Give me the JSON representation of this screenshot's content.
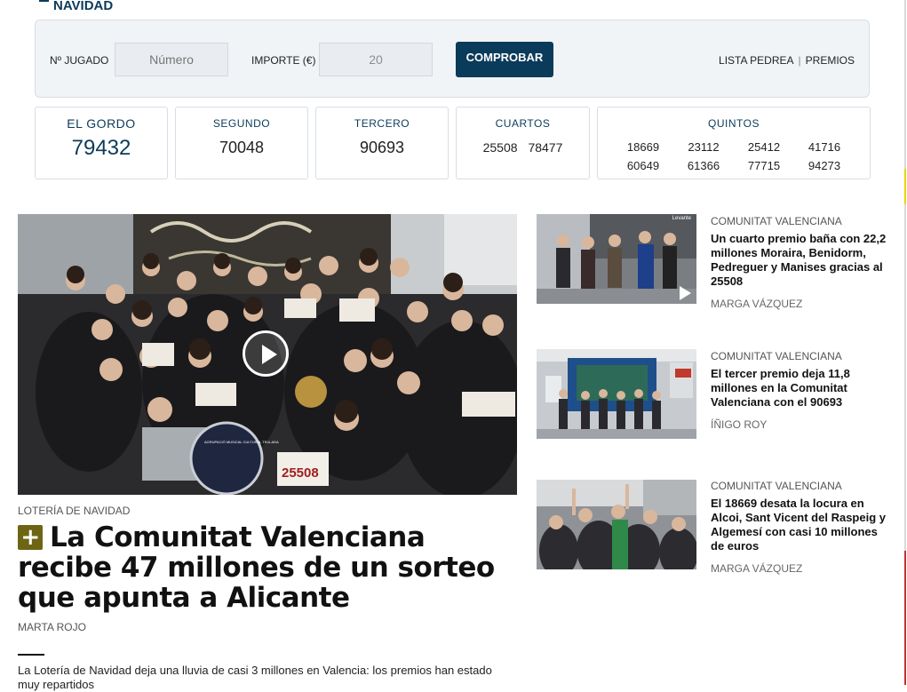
{
  "section": {
    "title": "NAVIDAD"
  },
  "checker": {
    "number_label": "Nº JUGADO",
    "number_placeholder": "Número",
    "amount_label": "IMPORTE (€)",
    "amount_value": "20",
    "submit_label": "COMPROBAR",
    "links": [
      "LISTA PEDREA",
      "PREMIOS"
    ]
  },
  "prizes": {
    "gordo": {
      "title": "EL GORDO",
      "number": "79432"
    },
    "segundo": {
      "title": "SEGUNDO",
      "number": "70048"
    },
    "tercero": {
      "title": "TERCERO",
      "number": "90693"
    },
    "cuartos": {
      "title": "CUARTOS",
      "numbers": [
        "25508",
        "78477"
      ]
    },
    "quintos": {
      "title": "QUINTOS",
      "numbers": [
        "18669",
        "23112",
        "25412",
        "41716",
        "60649",
        "61366",
        "77715",
        "94273"
      ]
    }
  },
  "main_article": {
    "kicker": "LOTERÍA DE NAVIDAD",
    "badge": "+",
    "title": "La Comunitat Valenciana recibe 47 millones de un sorteo que apunta a Alicante",
    "author": "MARTA ROJO",
    "lead": "La Lotería de Navidad deja una lluvia de casi 3 millones en Valencia: los premios han estado muy repartidos",
    "image": {
      "ticket_text": "25508",
      "sign_text": "AGRUPACIÓ MUSICAL CULTURAL TEULADA"
    }
  },
  "side_articles": [
    {
      "kicker": "COMUNITAT VALENCIANA",
      "title": "Un cuarto premio baña con 22,2 millones Moraira, Benidorm, Pedreguer y Manises gracias al 25508",
      "author": "MARGA VÁZQUEZ",
      "watermark": "Levante"
    },
    {
      "kicker": "COMUNITAT VALENCIANA",
      "title": "El tercer premio deja 11,8 millones en la Comunitat Valenciana con el 90693",
      "author": "ÍÑIGO ROY"
    },
    {
      "kicker": "COMUNITAT VALENCIANA",
      "title": "El 18669 desata la locura en Alcoi, Sant Vicent del Raspeig y Algemesí con casi 10 millones de euros",
      "author": "MARGA VÁZQUEZ"
    }
  ]
}
